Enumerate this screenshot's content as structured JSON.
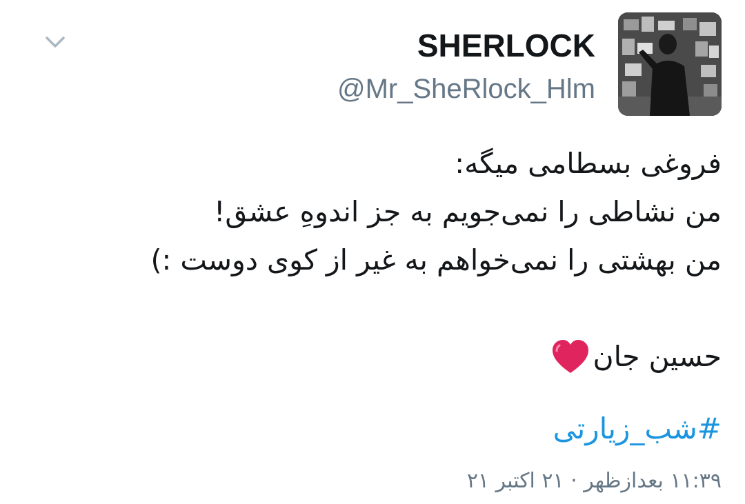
{
  "header": {
    "display_name": "SHERLOCK",
    "handle": "@Mr_SheRlock_Hlm",
    "avatar_icon": "profile-photo-avatar",
    "menu_icon": "chevron-down-icon"
  },
  "tweet": {
    "lines": [
      "فروغی بسطامی میگه:",
      "من نشاطی را نمی‌جویم به جز اندوهِ عشق!",
      "من بهشتی را نمی‌خواهم به غیر از کوی دوست :)"
    ],
    "signature": "حسین جان",
    "signature_icon": "red-heart-icon",
    "hashtag": "#شب_زیارتی",
    "timestamp": "۱۱:۳۹ بعدازظهر · ۲۱ اکتبر ۲۱"
  },
  "colors": {
    "text": "#14171a",
    "secondary": "#657786",
    "link": "#1b95e0",
    "heart": "#e0245e"
  }
}
